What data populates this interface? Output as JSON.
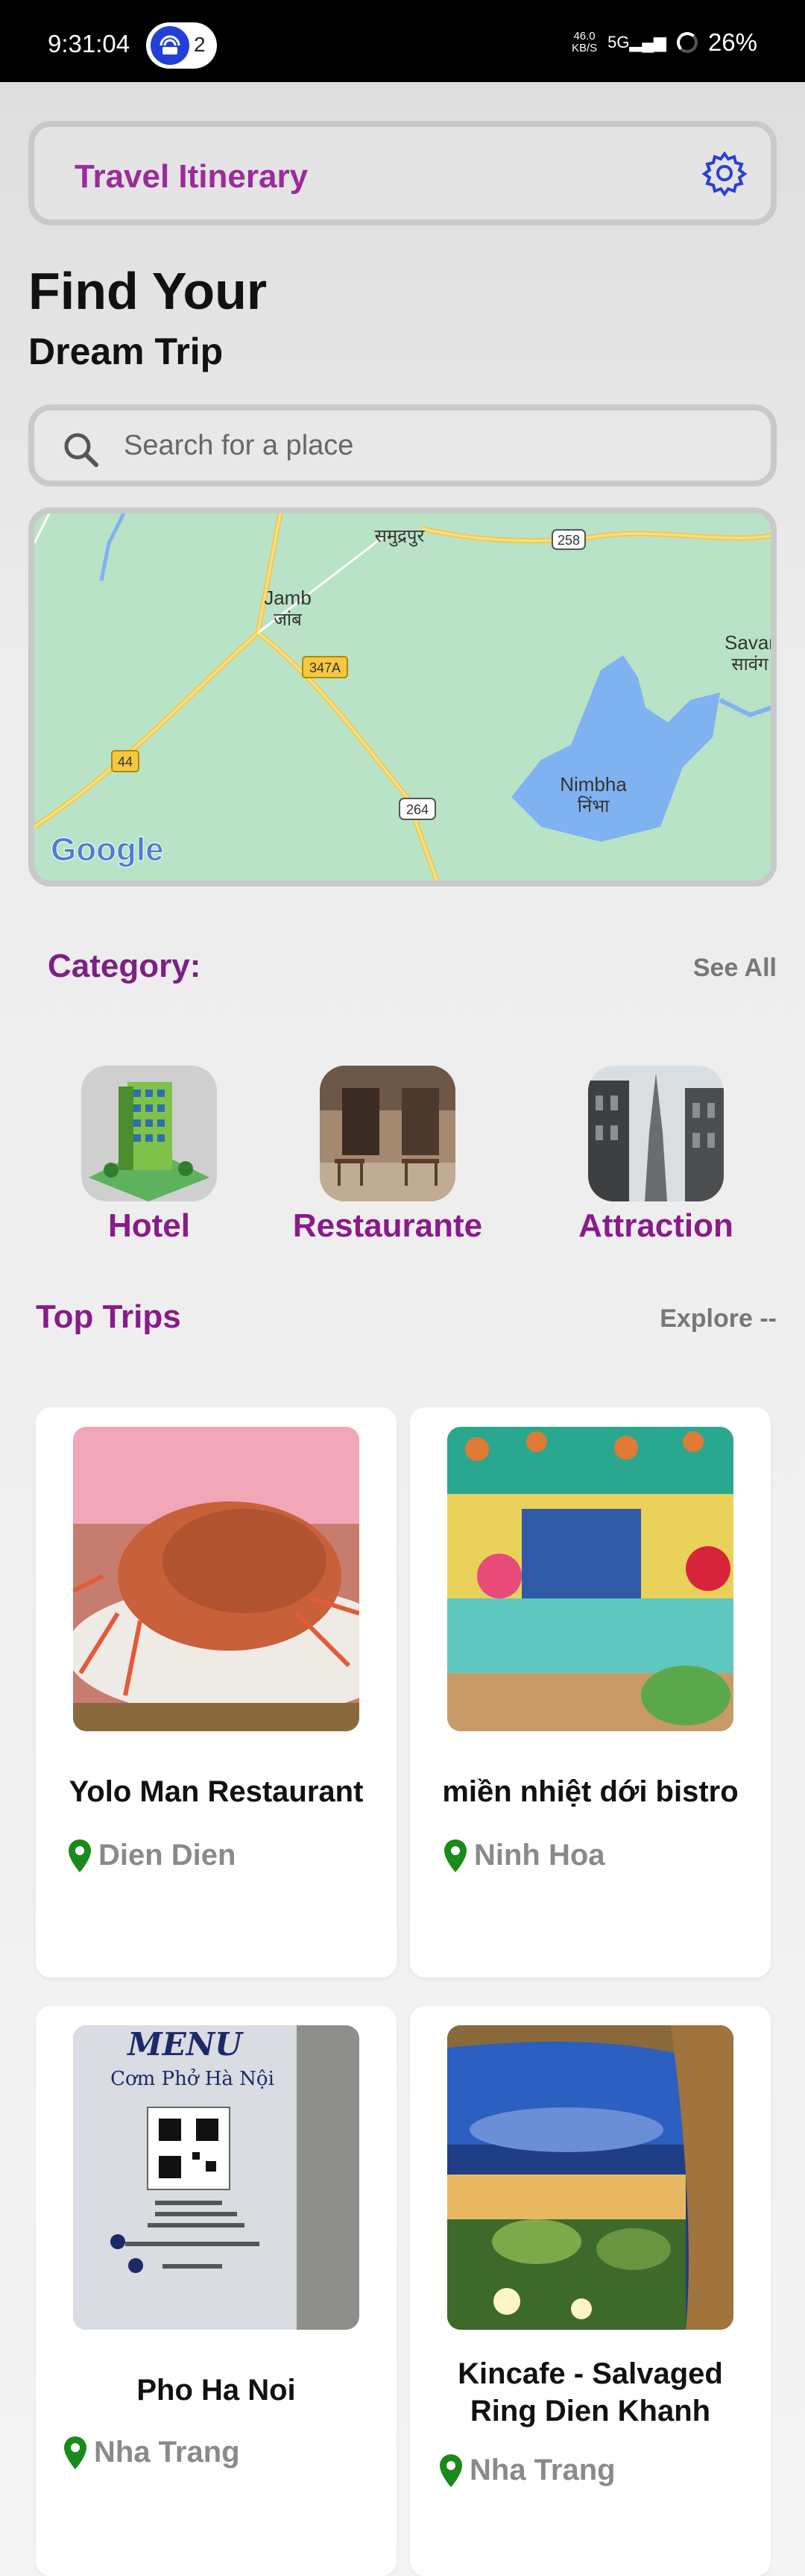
{
  "status_bar": {
    "time": "9:31:04",
    "notification_count": "2",
    "net_speed_top": "46.0",
    "net_speed_bottom": "KB/S",
    "signal_label": "5G",
    "battery": "26%"
  },
  "header": {
    "title": "Travel Itinerary",
    "settings_icon": "gear-icon"
  },
  "hero": {
    "line1": "Find Your",
    "line2": "Dream Trip"
  },
  "search": {
    "placeholder": "Search for a place",
    "icon": "search-icon"
  },
  "map": {
    "labels": [
      {
        "text": "समुद्रपुर"
      },
      {
        "text": "Jamb"
      },
      {
        "text": "जांब"
      },
      {
        "text": "258"
      },
      {
        "text": "347A"
      },
      {
        "text": "44"
      },
      {
        "text": "264"
      },
      {
        "text": "Nimbha"
      },
      {
        "text": "निंभा"
      },
      {
        "text": "Savar"
      },
      {
        "text": "सावंग"
      }
    ],
    "provider": "Google"
  },
  "categories": {
    "title": "Category:",
    "see_all": "See All",
    "items": [
      {
        "label": "Hotel"
      },
      {
        "label": "Restaurante"
      },
      {
        "label": "Attraction"
      }
    ]
  },
  "top_trips": {
    "title": "Top Trips",
    "explore": "Explore --",
    "items": [
      {
        "name": "Yolo Man Restaurant",
        "location": "Dien Dien"
      },
      {
        "name": "miền nhiệt dới bistro",
        "location": "Ninh Hoa"
      },
      {
        "name": "Pho Ha Noi",
        "location": "Nha Trang"
      },
      {
        "name": "Kincafe - Salvaged Ring Dien Khanh",
        "location": "Nha Trang"
      }
    ]
  },
  "menu_photo_text": {
    "line1": "MENU",
    "line2": "Cơm Phở Hà Nội"
  },
  "colors": {
    "accent_purple": "#8a1a8a",
    "header_purple": "#9b2b9b",
    "pin_green": "#1a8a1a",
    "gear_blue": "#2c3fd6"
  }
}
